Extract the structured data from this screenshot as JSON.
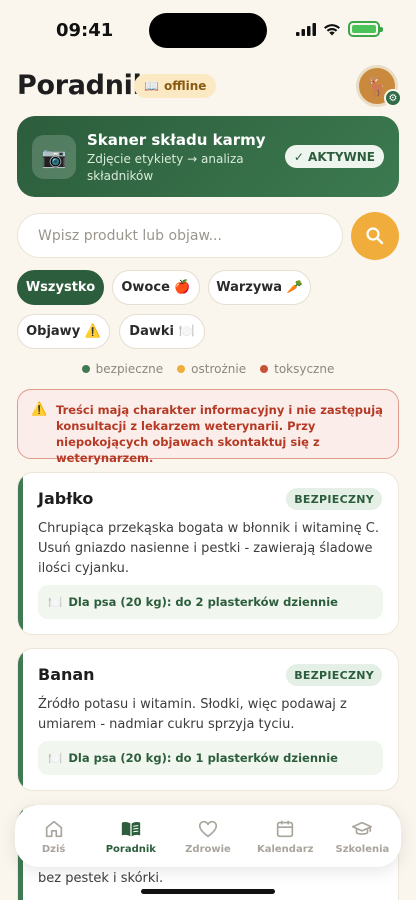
{
  "status_bar": {
    "time": "09:41"
  },
  "header": {
    "title": "Poradnik",
    "offline_badge": "offline",
    "avatar_emoji": "🦌"
  },
  "scanner": {
    "title": "Skaner składu karmy",
    "subtitle": "Zdjęcie etykiety → analiza składników",
    "badge": "✓ AKTYWNE"
  },
  "search": {
    "placeholder": "Wpisz produkt lub objaw..."
  },
  "filters": [
    {
      "label": "Wszystko",
      "active": true
    },
    {
      "label": "Owoce 🍎",
      "active": false
    },
    {
      "label": "Warzywa 🥕",
      "active": false
    },
    {
      "label": "Objawy ⚠️",
      "active": false
    },
    {
      "label": "Dawki 🍽️",
      "active": false
    }
  ],
  "legend": [
    {
      "label": "bezpieczne",
      "color": "#3f7a52"
    },
    {
      "label": "ostrożnie",
      "color": "#f0ad3b"
    },
    {
      "label": "toksyczne",
      "color": "#c65138"
    }
  ],
  "warning": {
    "icon": "⚠️",
    "text": "Treści mają charakter informacyjny i nie zastępują konsultacji z lekarzem weterynarii. Przy niepokojących objawach skontaktuj się z weterynarzem."
  },
  "cards": [
    {
      "title": "Jabłko",
      "badge": "BEZPIECZNY",
      "description": "Chrupiąca przekąska bogata w błonnik i witaminę C. Usuń gniazdo nasienne i pestki - zawierają śladowe ilości cyjanku.",
      "dose": "Dla psa (20 kg): do 2 plasterków dziennie"
    },
    {
      "title": "Banan",
      "badge": "BEZPIECZNY",
      "description": "Źródło potasu i witamin. Słodki, więc podawaj z umiarem - nadmiar cukru sprzyja tyciu.",
      "dose": "Dla psa (20 kg): do 1 plasterków dziennie"
    },
    {
      "description_tail": "bez pestek i skórki."
    }
  ],
  "nav": [
    {
      "label": "Dziś",
      "icon": "home-icon",
      "active": false
    },
    {
      "label": "Poradnik",
      "icon": "book-icon",
      "active": true
    },
    {
      "label": "Zdrowie",
      "icon": "heart-icon",
      "active": false
    },
    {
      "label": "Kalendarz",
      "icon": "calendar-icon",
      "active": false
    },
    {
      "label": "Szkolenia",
      "icon": "graduation-cap-icon",
      "active": false
    }
  ]
}
